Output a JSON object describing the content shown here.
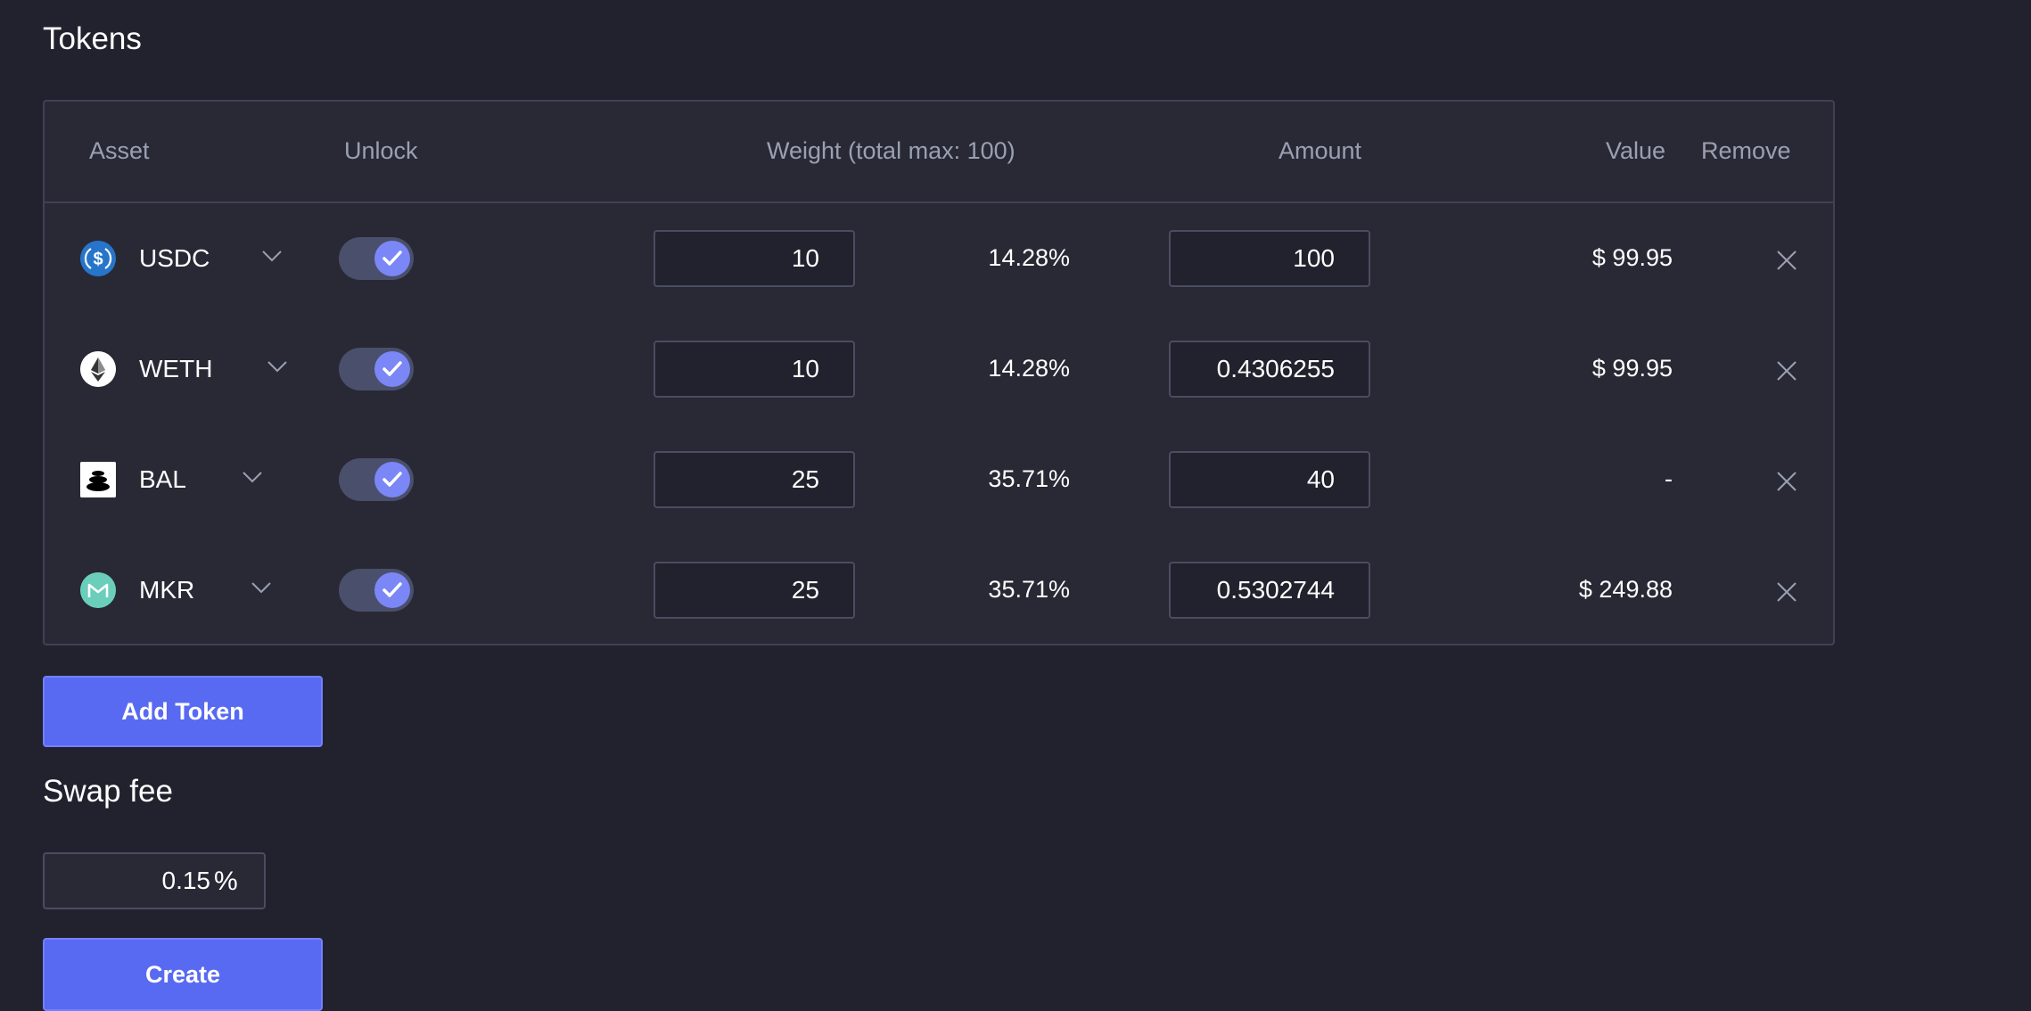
{
  "tokens_title": "Tokens",
  "table": {
    "headers": {
      "asset": "Asset",
      "unlock": "Unlock",
      "weight": "Weight (total max: 100)",
      "amount": "Amount",
      "value": "Value",
      "remove": "Remove"
    },
    "rows": [
      {
        "symbol": "USDC",
        "icon": "usdc-icon",
        "unlocked": true,
        "weight": "10",
        "percent": "14.28%",
        "amount": "100",
        "value": "$ 99.95"
      },
      {
        "symbol": "WETH",
        "icon": "weth-icon",
        "unlocked": true,
        "weight": "10",
        "percent": "14.28%",
        "amount": "0.4306255",
        "value": "$ 99.95"
      },
      {
        "symbol": "BAL",
        "icon": "bal-icon",
        "unlocked": true,
        "weight": "25",
        "percent": "35.71%",
        "amount": "40",
        "value": "-"
      },
      {
        "symbol": "MKR",
        "icon": "mkr-icon",
        "unlocked": true,
        "weight": "25",
        "percent": "35.71%",
        "amount": "0.5302744",
        "value": "$ 249.88"
      }
    ]
  },
  "add_token_label": "Add Token",
  "swap_fee": {
    "title": "Swap fee",
    "value": "0.15",
    "unit": "%"
  },
  "create_label": "Create",
  "colors": {
    "background": "#21222d",
    "panel": "#282935",
    "accent": "#5869f2",
    "toggle_knob": "#7b86f7"
  }
}
